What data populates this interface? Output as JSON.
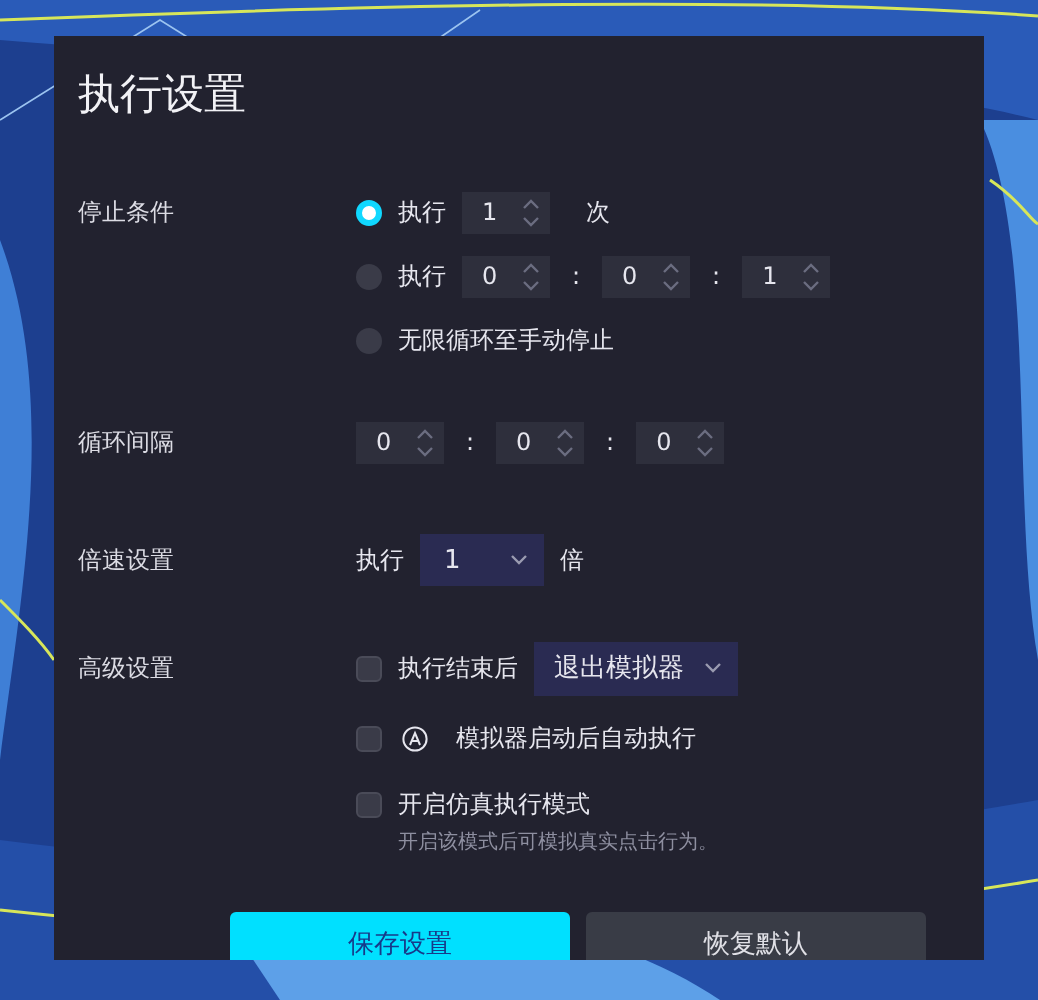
{
  "dialog": {
    "title": "执行设置"
  },
  "stop_condition": {
    "label": "停止条件",
    "options": [
      {
        "kind": "count",
        "selected": true,
        "prefix": "执行",
        "value": "1",
        "suffix": "次"
      },
      {
        "kind": "time",
        "selected": false,
        "prefix": "执行",
        "fields": [
          "0",
          "0",
          "1"
        ],
        "separators": [
          ":",
          ":"
        ]
      },
      {
        "kind": "text",
        "selected": false,
        "label": "无限循环至手动停止"
      }
    ]
  },
  "loop_interval": {
    "label": "循环间隔",
    "fields": [
      "0",
      "0",
      "0"
    ],
    "separators": [
      ":",
      ":"
    ]
  },
  "speed": {
    "label": "倍速设置",
    "prefix": "执行",
    "value": "1",
    "suffix": "倍"
  },
  "advanced": {
    "label": "高级设置",
    "options": [
      {
        "kind": "dropdown",
        "checked": false,
        "label": "执行结束后",
        "value": "退出模拟器"
      },
      {
        "kind": "icon",
        "checked": false,
        "label": "模拟器启动后自动执行"
      },
      {
        "kind": "hint",
        "checked": false,
        "label": "开启仿真执行模式",
        "hint": "开启该模式后可模拟真实点击行为。"
      }
    ]
  },
  "buttons": [
    {
      "label": "保存设置",
      "kind": "primary"
    },
    {
      "label": "恢复默认",
      "kind": "secondary"
    }
  ]
}
